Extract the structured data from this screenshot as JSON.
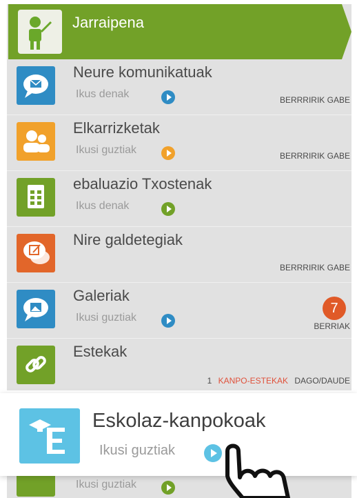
{
  "colors": {
    "green": "#72a128",
    "blue": "#2f8cc4",
    "orange": "#f1a12b",
    "red_orange": "#e2662a",
    "light_blue": "#5dc2e4",
    "badge": "#e05a28",
    "link_red": "#e0513b"
  },
  "header": {
    "title": "Jarraipena",
    "icon": "teacher-icon"
  },
  "items": [
    {
      "title": "Neure komunikatuak",
      "sub": "Ikus denak",
      "status": "BERRRIRIK GABE",
      "icon": "envelope-chat-icon"
    },
    {
      "title": "Elkarrizketak",
      "sub": "Ikusi guztiak",
      "status": "BERRRIRIK GABE",
      "icon": "people-icon"
    },
    {
      "title": "ebaluazio Txostenak",
      "sub": "Ikus denak",
      "icon": "report-icon"
    },
    {
      "title": "Nire galdetegiak",
      "status": "BERRRIRIK GABE",
      "icon": "edit-chat-icon"
    },
    {
      "title": "Galeriak",
      "sub": "Ikusi guztiak",
      "badge": "7",
      "status": "BERRIAK",
      "icon": "gallery-icon"
    },
    {
      "title": "Estekak",
      "links_count": "1",
      "links_label": "KANPO-ESTEKAK",
      "links_suffix": "DAGO/DAUDE",
      "icon": "link-icon"
    }
  ],
  "highlight": {
    "title": "Eskolaz-kanpokoak",
    "sub": "Ikusi guztiak",
    "icon": "extracurricular-icon"
  },
  "below": {
    "sub": "Ikusi guztiak"
  },
  "cursor": {
    "icon": "hand-pointer-icon"
  }
}
